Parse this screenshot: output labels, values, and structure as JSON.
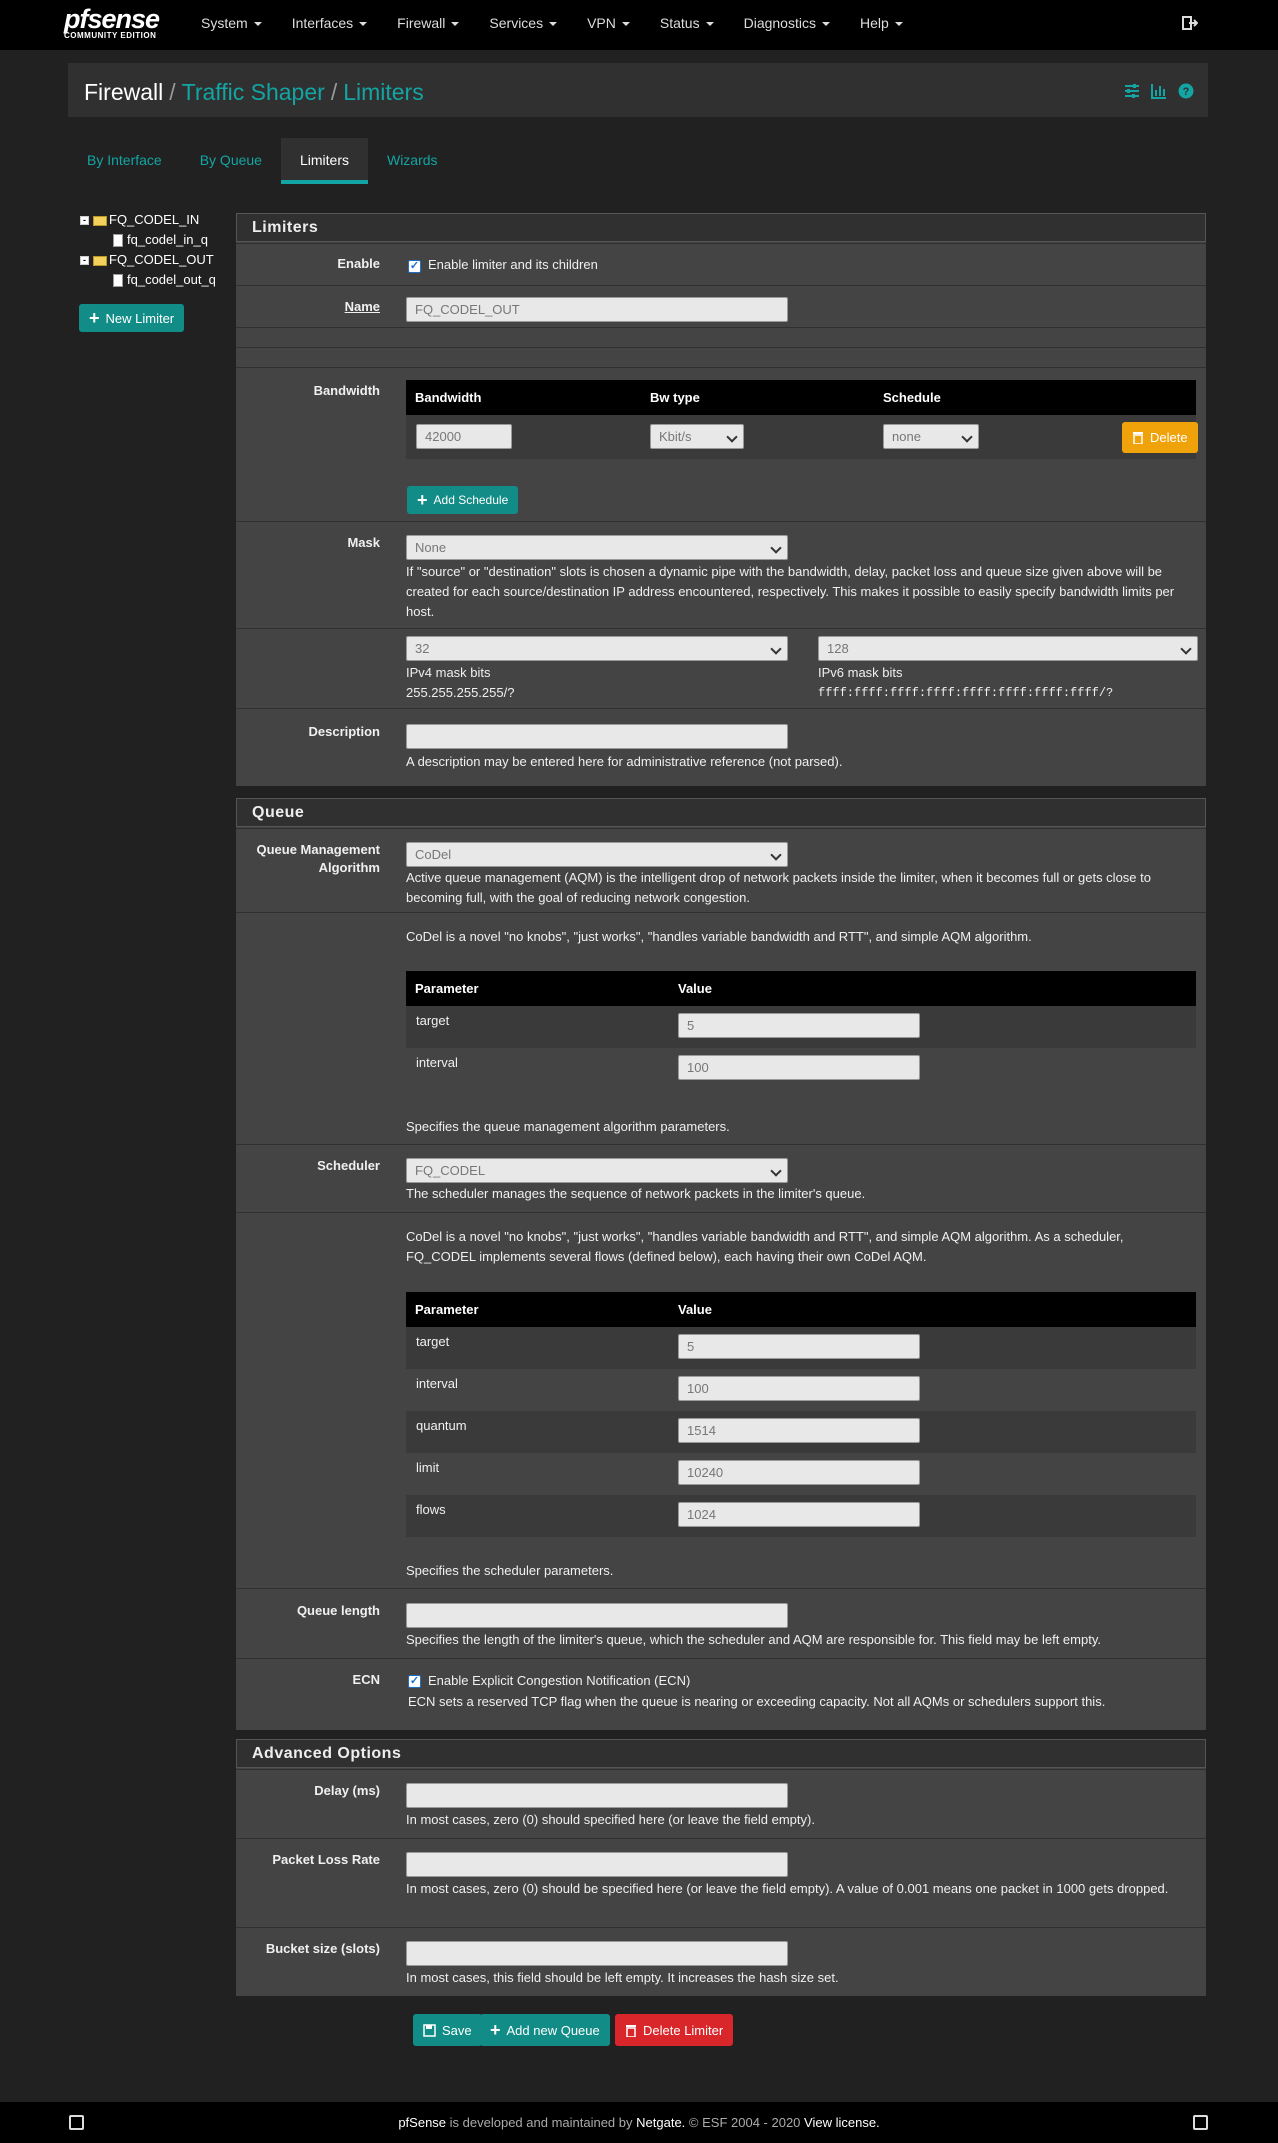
{
  "brand": {
    "name": "pfsense",
    "edition": "COMMUNITY EDITION"
  },
  "nav": {
    "items": [
      "System",
      "Interfaces",
      "Firewall",
      "Services",
      "VPN",
      "Status",
      "Diagnostics",
      "Help"
    ]
  },
  "breadcrumb": {
    "root": "Firewall",
    "level1": "Traffic Shaper",
    "level2": "Limiters"
  },
  "tabs": [
    "By Interface",
    "By Queue",
    "Limiters",
    "Wizards"
  ],
  "active_tab": "Limiters",
  "tree": {
    "nodes": [
      {
        "label": "FQ_CODEL_IN",
        "child": "fq_codel_in_q"
      },
      {
        "label": "FQ_CODEL_OUT",
        "child": "fq_codel_out_q"
      }
    ]
  },
  "new_limiter_label": "New Limiter",
  "limiters": {
    "heading": "Limiters",
    "enable_label": "Enable",
    "enable_text": "Enable limiter and its children",
    "name_label": "Name",
    "name_value": "FQ_CODEL_OUT",
    "bandwidth_label": "Bandwidth",
    "bw_headers": [
      "Bandwidth",
      "Bw type",
      "Schedule"
    ],
    "bw_value": "42000",
    "bw_type": "Kbit/s",
    "schedule": "none",
    "delete_label": "Delete",
    "add_schedule_label": "Add Schedule",
    "mask_label": "Mask",
    "mask_value": "None",
    "mask_help": "If \"source\" or \"destination\" slots is chosen a dynamic pipe with the bandwidth, delay, packet loss and queue size given above will be created for each source/destination IP address encountered, respectively. This makes it possible to easily specify bandwidth limits per host.",
    "ipv4_bits": "32",
    "ipv4_label": "IPv4 mask bits",
    "ipv4_example": "255.255.255.255/?",
    "ipv6_bits": "128",
    "ipv6_label": "IPv6 mask bits",
    "ipv6_example": "ffff:ffff:ffff:ffff:ffff:ffff:ffff:ffff/?",
    "description_label": "Description",
    "description_value": "",
    "description_help": "A description may be entered here for administrative reference (not parsed)."
  },
  "queue": {
    "heading": "Queue",
    "qma_label": "Queue Management Algorithm",
    "qma_value": "CoDel",
    "qma_help": "Active queue management (AQM) is the intelligent drop of network packets inside the limiter, when it becomes full or gets close to becoming full, with the goal of reducing network congestion.",
    "codel_desc": "CoDel is a novel \"no knobs\", \"just works\", \"handles variable bandwidth and RTT\", and simple AQM algorithm.",
    "param_headers": [
      "Parameter",
      "Value"
    ],
    "aqm_params": [
      {
        "name": "target",
        "value": "5"
      },
      {
        "name": "interval",
        "value": "100"
      }
    ],
    "aqm_params_help": "Specifies the queue management algorithm parameters.",
    "scheduler_label": "Scheduler",
    "scheduler_value": "FQ_CODEL",
    "scheduler_help": "The scheduler manages the sequence of network packets in the limiter's queue.",
    "sched_desc": "CoDel is a novel \"no knobs\", \"just works\", \"handles variable bandwidth and RTT\", and simple AQM algorithm. As a scheduler, FQ_CODEL implements several flows (defined below), each having their own CoDel AQM.",
    "sched_params": [
      {
        "name": "target",
        "value": "5"
      },
      {
        "name": "interval",
        "value": "100"
      },
      {
        "name": "quantum",
        "value": "1514"
      },
      {
        "name": "limit",
        "value": "10240"
      },
      {
        "name": "flows",
        "value": "1024"
      }
    ],
    "sched_params_help": "Specifies the scheduler parameters.",
    "qlen_label": "Queue length",
    "qlen_value": "",
    "qlen_help": "Specifies the length of the limiter's queue, which the scheduler and AQM are responsible for. This field may be left empty.",
    "ecn_label": "ECN",
    "ecn_text": "Enable Explicit Congestion Notification (ECN)",
    "ecn_help": "ECN sets a reserved TCP flag when the queue is nearing or exceeding capacity. Not all AQMs or schedulers support this."
  },
  "advanced": {
    "heading": "Advanced Options",
    "delay_label": "Delay (ms)",
    "delay_value": "",
    "delay_help": "In most cases, zero (0) should specified here (or leave the field empty).",
    "plr_label": "Packet Loss Rate",
    "plr_value": "",
    "plr_help": "In most cases, zero (0) should be specified here (or leave the field empty). A value of 0.001 means one packet in 1000 gets dropped.",
    "bucket_label": "Bucket size (slots)",
    "bucket_value": "",
    "bucket_help": "In most cases, this field should be left empty. It increases the hash size set."
  },
  "actions": {
    "save": "Save",
    "add_queue": "Add new Queue",
    "delete_limiter": "Delete Limiter"
  },
  "footer": {
    "brand": "pfSense",
    "text1": "is developed and maintained by",
    "company": "Netgate.",
    "text2": "© ESF 2004 - 2020",
    "license": "View license."
  },
  "colors": {
    "accent": "#13a5a3",
    "orange": "#f0a20b",
    "red": "#d9262a"
  }
}
